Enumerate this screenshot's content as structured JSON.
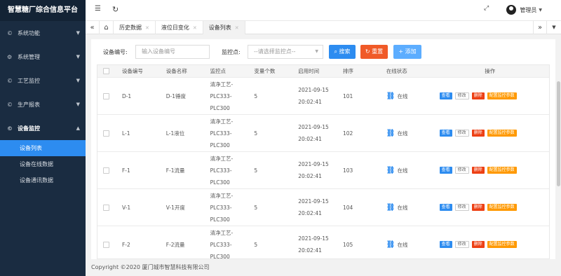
{
  "app": {
    "title": "智慧糖厂综合信息平台"
  },
  "sidebar": {
    "items": [
      {
        "label": "系统功能",
        "icon": "©"
      },
      {
        "label": "系统管理",
        "icon": "⚙"
      },
      {
        "label": "工艺监控",
        "icon": "©"
      },
      {
        "label": "生产报表",
        "icon": "©"
      },
      {
        "label": "设备监控",
        "icon": "©"
      }
    ],
    "submenu": [
      {
        "label": "设备列表"
      },
      {
        "label": "设备在线数据"
      },
      {
        "label": "设备通讯数据"
      }
    ]
  },
  "topbar": {
    "user_name": "管理员"
  },
  "tabs": [
    {
      "label": "历史数据"
    },
    {
      "label": "液位日变化"
    },
    {
      "label": "设备列表"
    }
  ],
  "filters": {
    "device_no_label": "设备编号:",
    "device_no_placeholder": "输入设备编号",
    "point_label": "监控点:",
    "point_placeholder": "--请选择监控点--",
    "search_label": "搜索",
    "reset_label": "重置",
    "add_label": "添加"
  },
  "colors": {
    "primary": "#2d8cf0",
    "danger": "#ed4014",
    "warning": "#ff9900",
    "sidebar": "#1a2c41",
    "reset": "#f05a28",
    "add": "#5cadff"
  },
  "table": {
    "headers": [
      "设备编号",
      "设备名称",
      "监控点",
      "变量个数",
      "启用时间",
      "排序",
      "在线状态",
      "操作"
    ],
    "op_labels": {
      "view": "查看",
      "edit": "修改",
      "del": "删除",
      "cfg": "配置监控参数"
    },
    "rows": [
      {
        "no": "D-1",
        "name": "D-1锤度",
        "point": [
          "清净工艺-",
          "PLC333-",
          "PLC300"
        ],
        "vars": "5",
        "time": [
          "2021-09-15",
          "20:02:41"
        ],
        "sort": "101",
        "status": "在线"
      },
      {
        "no": "L-1",
        "name": "L-1液位",
        "point": [
          "清净工艺-",
          "PLC333-",
          "PLC300"
        ],
        "vars": "5",
        "time": [
          "2021-09-15",
          "20:02:41"
        ],
        "sort": "102",
        "status": "在线"
      },
      {
        "no": "F-1",
        "name": "F-1流量",
        "point": [
          "清净工艺-",
          "PLC333-",
          "PLC300"
        ],
        "vars": "5",
        "time": [
          "2021-09-15",
          "20:02:41"
        ],
        "sort": "103",
        "status": "在线"
      },
      {
        "no": "V-1",
        "name": "V-1开度",
        "point": [
          "清净工艺-",
          "PLC333-",
          "PLC300"
        ],
        "vars": "5",
        "time": [
          "2021-09-15",
          "20:02:41"
        ],
        "sort": "104",
        "status": "在线"
      },
      {
        "no": "F-2",
        "name": "F-2流量",
        "point": [
          "清净工艺-",
          "PLC333-",
          "PLC300"
        ],
        "vars": "5",
        "time": [
          "2021-09-15",
          "20:02:41"
        ],
        "sort": "105",
        "status": "在线"
      }
    ]
  },
  "footer": {
    "text": "Copyright ©2020 厦门城市智慧科技有限公司"
  }
}
